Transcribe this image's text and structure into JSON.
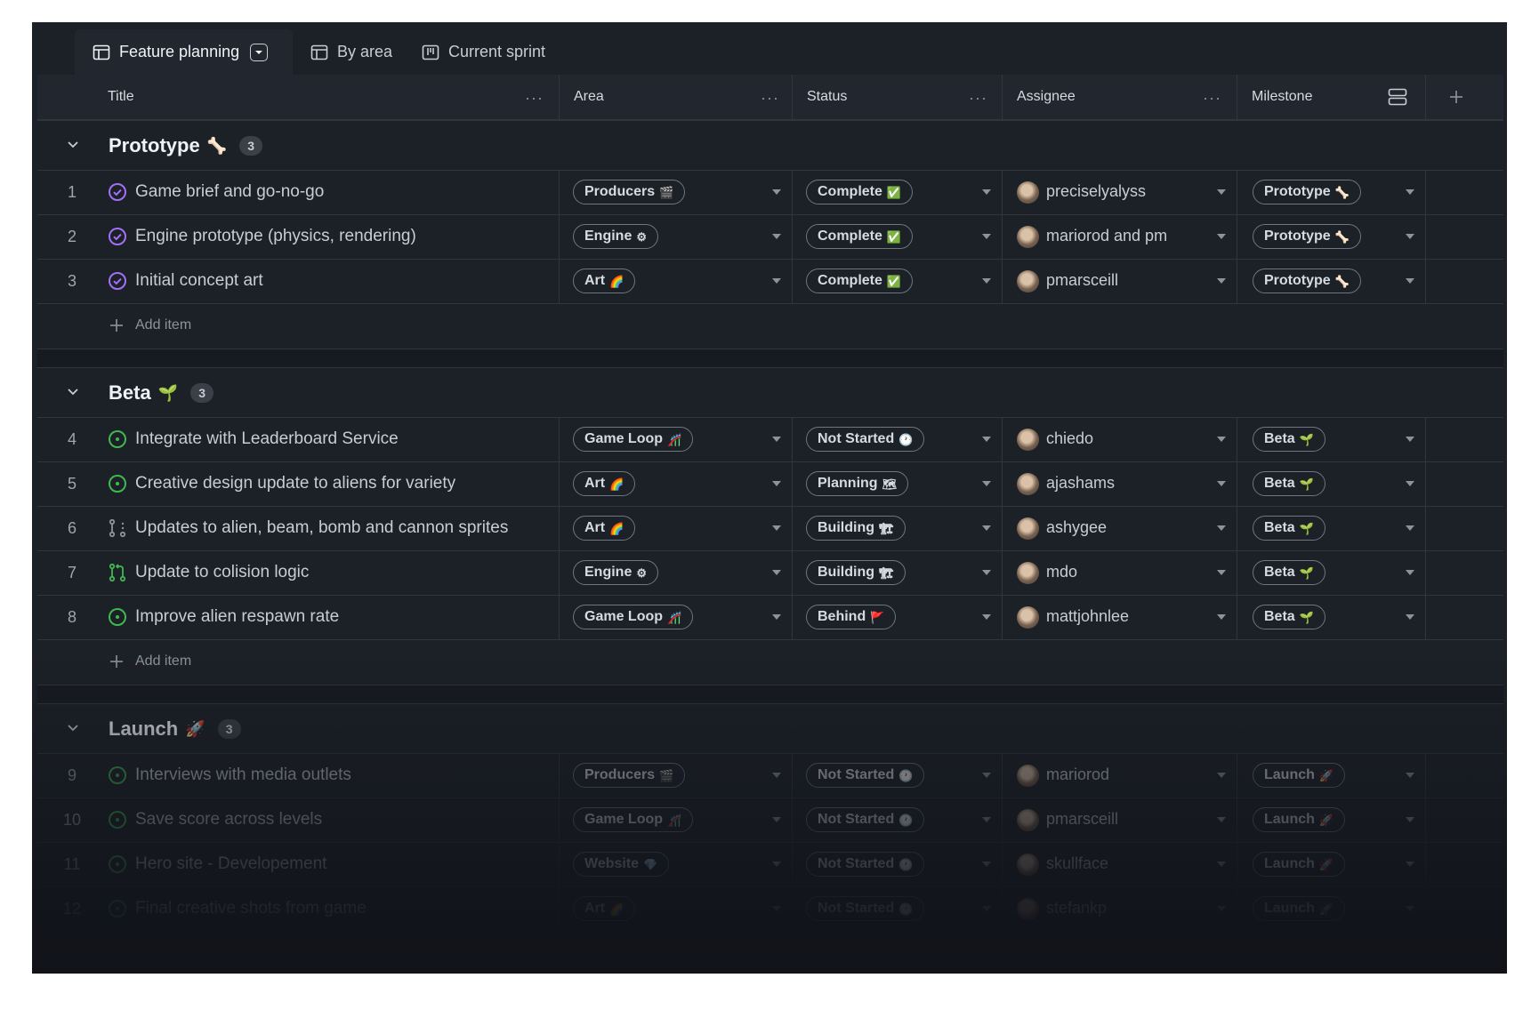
{
  "tabs": [
    {
      "label": "Feature planning",
      "icon": "table-icon",
      "active": true
    },
    {
      "label": "By area",
      "icon": "table-icon",
      "active": false
    },
    {
      "label": "Current sprint",
      "icon": "board-icon",
      "active": false
    }
  ],
  "columns": {
    "title": "Title",
    "area": "Area",
    "status": "Status",
    "assignee": "Assignee",
    "milestone": "Milestone"
  },
  "add_item_label": "Add item",
  "groups": [
    {
      "name": "Prototype",
      "emoji": "🦴",
      "count": "3",
      "rows": [
        {
          "n": "1",
          "title": "Game brief and go-no-go",
          "icon": "closed-issue-icon",
          "area": "Producers",
          "area_emoji": "🎬",
          "status": "Complete",
          "status_emoji": "✅",
          "assignee": "preciselyalyss",
          "milestone": "Prototype",
          "milestone_emoji": "🦴"
        },
        {
          "n": "2",
          "title": "Engine prototype (physics, rendering)",
          "icon": "closed-issue-icon",
          "area": "Engine",
          "area_emoji": "⚙",
          "status": "Complete",
          "status_emoji": "✅",
          "assignee": "mariorod and pm",
          "milestone": "Prototype",
          "milestone_emoji": "🦴"
        },
        {
          "n": "3",
          "title": "Initial concept art",
          "icon": "closed-issue-icon",
          "area": "Art",
          "area_emoji": "🌈",
          "status": "Complete",
          "status_emoji": "✅",
          "assignee": "pmarsceill",
          "milestone": "Prototype",
          "milestone_emoji": "🦴"
        }
      ]
    },
    {
      "name": "Beta",
      "emoji": "🌱",
      "count": "3",
      "rows": [
        {
          "n": "4",
          "title": "Integrate with Leaderboard Service",
          "icon": "open-issue-icon",
          "area": "Game Loop",
          "area_emoji": "🎢",
          "status": "Not Started",
          "status_emoji": "🕐",
          "assignee": "chiedo",
          "milestone": "Beta",
          "milestone_emoji": "🌱"
        },
        {
          "n": "5",
          "title": "Creative design update to aliens for variety",
          "icon": "open-issue-icon",
          "area": "Art",
          "area_emoji": "🌈",
          "status": "Planning",
          "status_emoji": "🗺",
          "assignee": "ajashams",
          "milestone": "Beta",
          "milestone_emoji": "🌱"
        },
        {
          "n": "6",
          "title": "Updates to alien, beam, bomb and cannon sprites",
          "icon": "draft-pr-icon",
          "area": "Art",
          "area_emoji": "🌈",
          "status": "Building",
          "status_emoji": "🏗",
          "assignee": "ashygee",
          "milestone": "Beta",
          "milestone_emoji": "🌱"
        },
        {
          "n": "7",
          "title": "Update to colision logic",
          "icon": "pull-request-icon",
          "area": "Engine",
          "area_emoji": "⚙",
          "status": "Building",
          "status_emoji": "🏗",
          "assignee": "mdo",
          "milestone": "Beta",
          "milestone_emoji": "🌱"
        },
        {
          "n": "8",
          "title": "Improve alien respawn rate",
          "icon": "open-issue-icon",
          "area": "Game Loop",
          "area_emoji": "🎢",
          "status": "Behind",
          "status_emoji": "🚩",
          "assignee": "mattjohnlee",
          "milestone": "Beta",
          "milestone_emoji": "🌱"
        }
      ]
    },
    {
      "name": "Launch",
      "emoji": "🚀",
      "count": "3",
      "rows": [
        {
          "n": "9",
          "title": "Interviews with media outlets",
          "icon": "open-issue-icon",
          "area": "Producers",
          "area_emoji": "🎬",
          "status": "Not Started",
          "status_emoji": "🕐",
          "assignee": "mariorod",
          "milestone": "Launch",
          "milestone_emoji": "🚀"
        },
        {
          "n": "10",
          "title": "Save score across levels",
          "icon": "open-issue-icon",
          "area": "Game Loop",
          "area_emoji": "🎢",
          "status": "Not Started",
          "status_emoji": "🕐",
          "assignee": "pmarsceill",
          "milestone": "Launch",
          "milestone_emoji": "🚀"
        },
        {
          "n": "11",
          "title": "Hero site - Developement",
          "icon": "open-issue-icon",
          "area": "Website",
          "area_emoji": "💎",
          "status": "Not Started",
          "status_emoji": "🕐",
          "assignee": "skullface",
          "milestone": "Launch",
          "milestone_emoji": "🚀"
        },
        {
          "n": "12",
          "title": "Final creative shots from game",
          "icon": "open-issue-icon",
          "area": "Art",
          "area_emoji": "🌈",
          "status": "Not Started",
          "status_emoji": "🕐",
          "assignee": "stefankp",
          "milestone": "Launch",
          "milestone_emoji": "🚀"
        }
      ]
    }
  ]
}
